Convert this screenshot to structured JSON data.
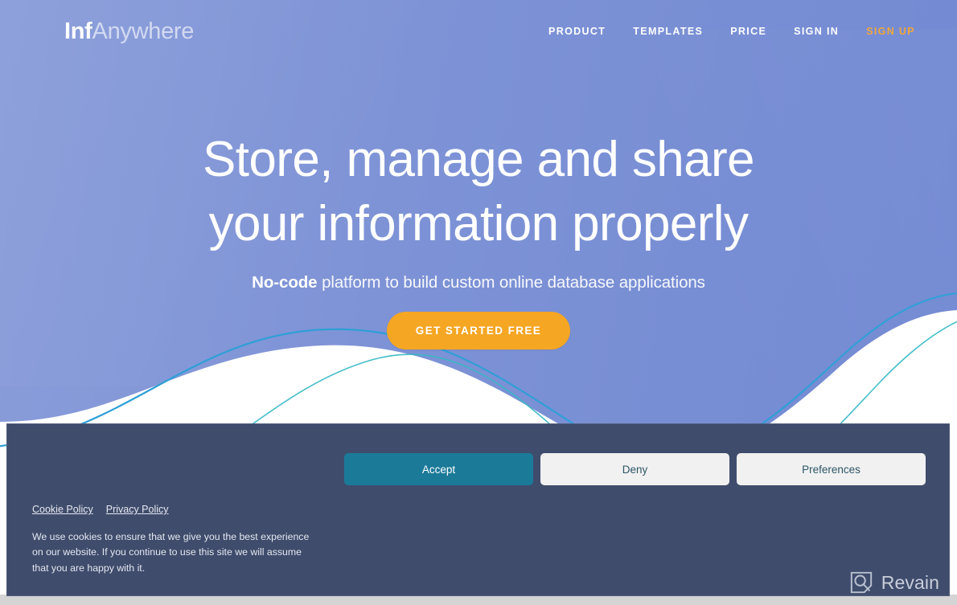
{
  "site": {
    "logo_primary": "Inf",
    "logo_secondary": "Anywhere",
    "accent_color": "#f5a623",
    "background_color": "#7e93d6"
  },
  "header": {
    "nav": [
      {
        "label": "PRODUCT",
        "accent": false
      },
      {
        "label": "TEMPLATES",
        "accent": false
      },
      {
        "label": "PRICE",
        "accent": false
      },
      {
        "label": "SIGN IN",
        "accent": false
      },
      {
        "label": "SIGN UP",
        "accent": true
      }
    ]
  },
  "hero": {
    "title_line1": "Store, manage and share",
    "title_line2": "your information properly",
    "subtitle_bold": "No-code",
    "subtitle_rest": " platform to build custom online database applications",
    "cta_label": "GET STARTED FREE"
  },
  "cookie_banner": {
    "accept_label": "Accept",
    "deny_label": "Deny",
    "preferences_label": "Preferences",
    "cookie_policy_label": "Cookie Policy",
    "privacy_policy_label": "Privacy Policy",
    "description": "We use cookies to ensure that we give you the best experience on our website. If you continue to use this site we will assume that you are happy with it.",
    "background_color": "#3f4c6c",
    "accept_color": "#1c7a99"
  },
  "watermark": {
    "label": "Revain",
    "icon": "revain-logo-icon"
  }
}
